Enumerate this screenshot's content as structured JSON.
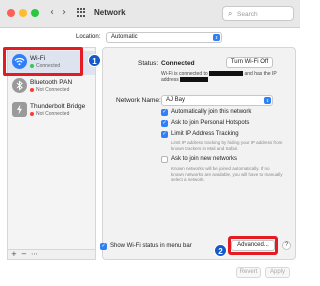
{
  "window": {
    "title": "Network"
  },
  "search": {
    "placeholder": "Search"
  },
  "location": {
    "label": "Location:",
    "value": "Automatic"
  },
  "sidebar": {
    "items": [
      {
        "name": "Wi-Fi",
        "status": "Connected",
        "status_color": "#34c759",
        "icon": "wifi-icon"
      },
      {
        "name": "Bluetooth PAN",
        "status": "Not Connected",
        "status_color": "#ff3b30",
        "icon": "bluetooth-icon"
      },
      {
        "name": "Thunderbolt Bridge",
        "status": "Not Connected",
        "status_color": "#ff3b30",
        "icon": "thunderbolt-icon"
      }
    ],
    "add_label": "+",
    "remove_label": "−",
    "action_label": "⋯"
  },
  "status": {
    "label": "Status:",
    "value": "Connected",
    "turn_off_label": "Turn Wi-Fi Off",
    "info_line1a": "Wi-Fi is connected to",
    "info_line1b": "and has the IP",
    "info_line2": "address"
  },
  "network_name": {
    "label": "Network Name:",
    "value": "AJ Bay"
  },
  "options": {
    "auto_join": {
      "label": "Automatically join this network",
      "checked": true
    },
    "hotspots": {
      "label": "Ask to join Personal Hotspots",
      "checked": true
    },
    "limit_ip": {
      "label": "Limit IP Address Tracking",
      "checked": true
    },
    "limit_ip_help": "Limit IP address tracking by hiding your IP address from known trackers in Mail and Safari.",
    "ask_new": {
      "label": "Ask to join new networks",
      "checked": false
    },
    "ask_new_help": "Known networks will be joined automatically. If no known networks are available, you will have to manually select a network."
  },
  "footer": {
    "show_wifi_label": "Show Wi-Fi status in menu bar",
    "advanced_label": "Advanced...",
    "help_label": "?",
    "revert_label": "Revert",
    "apply_label": "Apply"
  },
  "annotations": {
    "step1": "1",
    "step2": "2",
    "color": "#e41b23",
    "badge_color": "#1459c9"
  }
}
